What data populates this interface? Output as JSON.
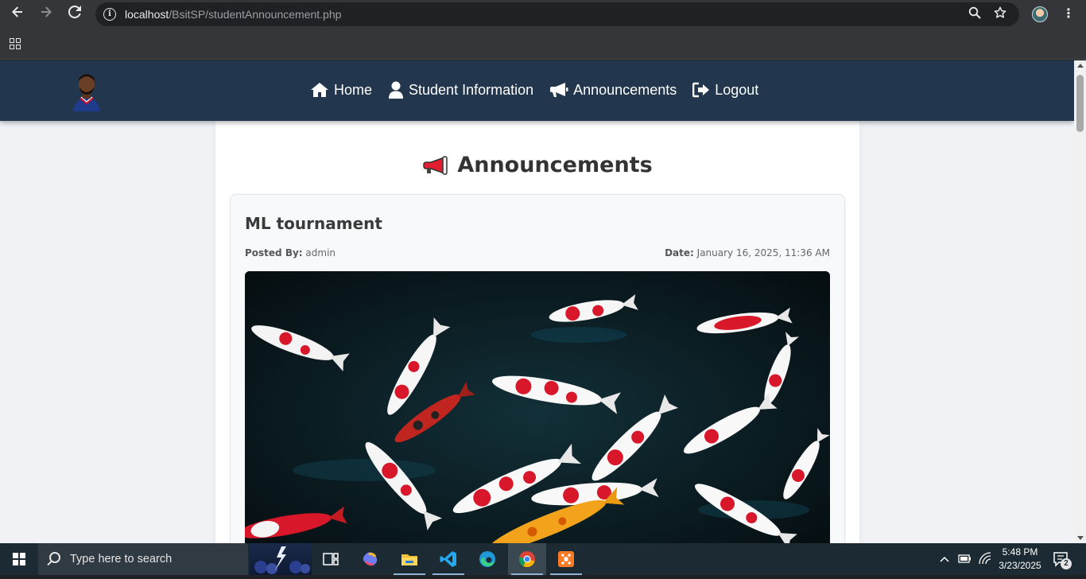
{
  "browser": {
    "url_host": "localhost",
    "url_path": "/BsitSP/studentAnnouncement.php"
  },
  "site_nav": {
    "items": [
      {
        "label": "Home",
        "icon": "home-icon"
      },
      {
        "label": "Student Information",
        "icon": "user-icon"
      },
      {
        "label": "Announcements",
        "icon": "bullhorn-icon"
      },
      {
        "label": "Logout",
        "icon": "logout-icon"
      }
    ],
    "background": "#22364d"
  },
  "page": {
    "heading_emoji": "📢",
    "heading": "Announcements"
  },
  "announcement": {
    "title": "ML tournament",
    "posted_by_label": "Posted By:",
    "posted_by": "admin",
    "date_label": "Date:",
    "date": "January 16, 2025, 11:36 AM",
    "image_subject": "koi-fish-pond-image"
  },
  "taskbar": {
    "search_placeholder": "Type here to search",
    "time": "5:48 PM",
    "date": "3/23/2025",
    "notification_count": "2"
  }
}
